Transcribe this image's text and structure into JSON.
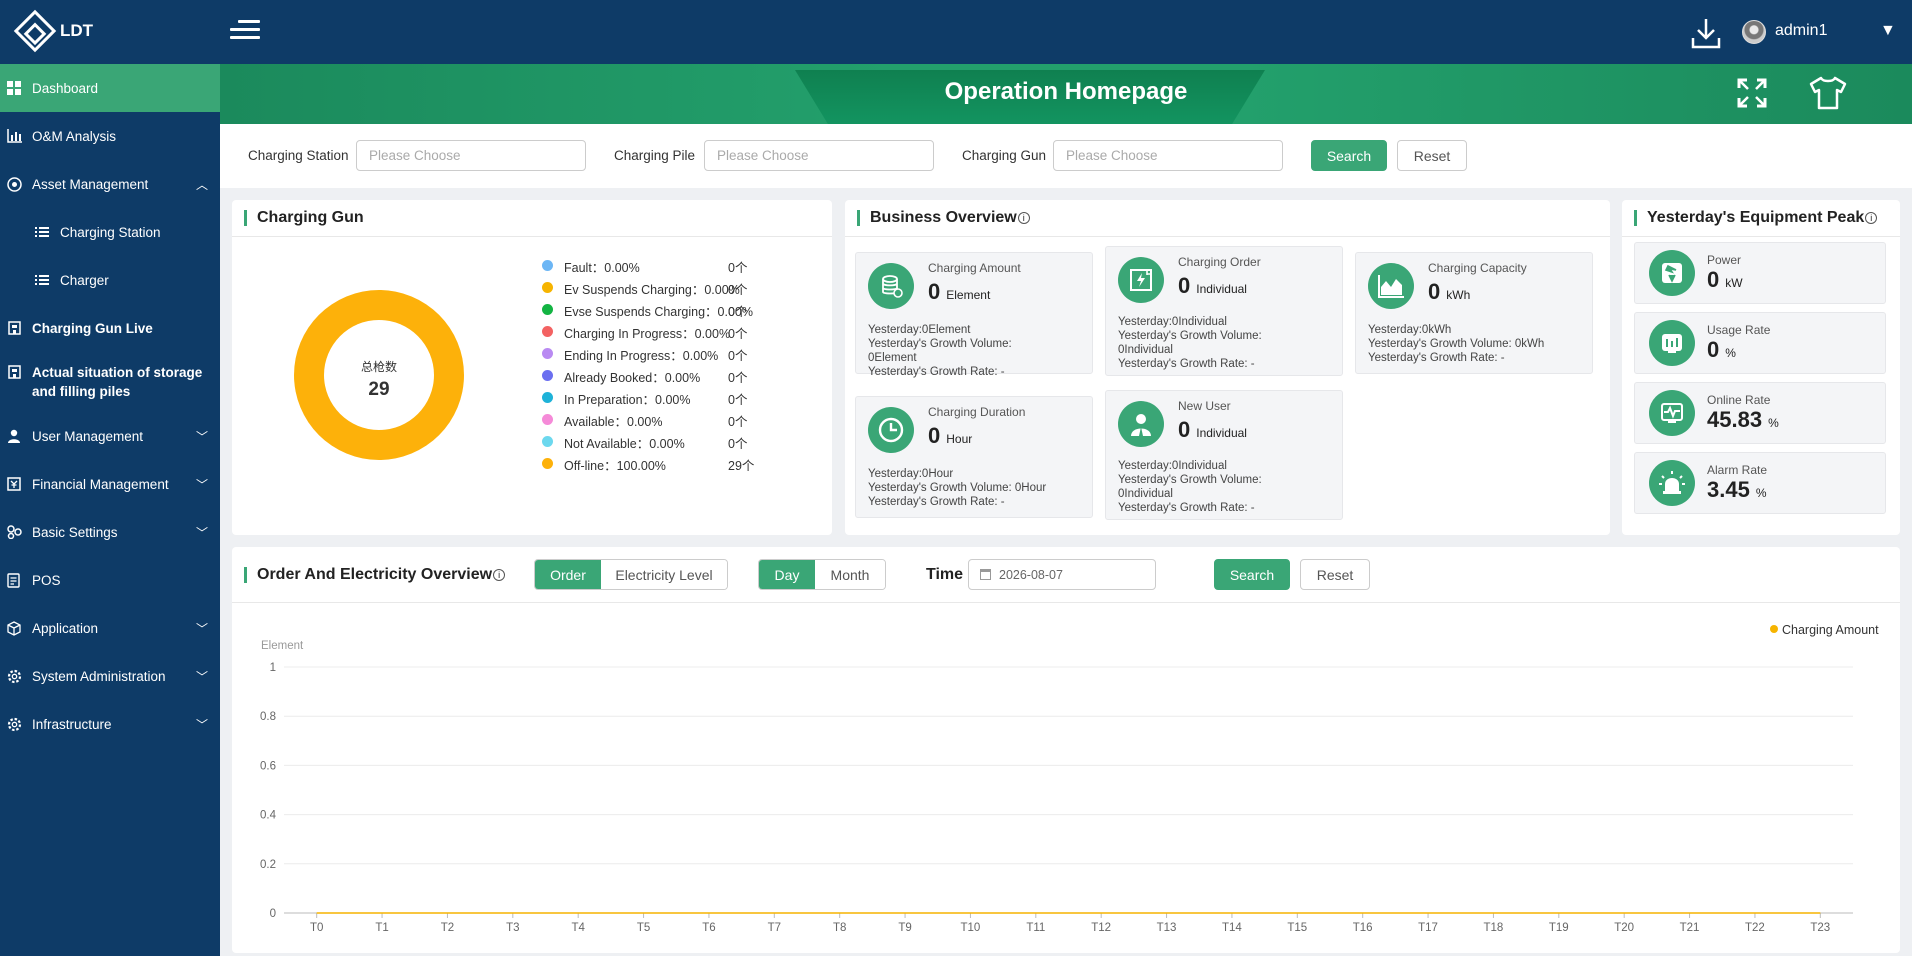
{
  "app": {
    "logo_text": "LDT"
  },
  "header": {
    "user_name": "admin1",
    "caret": "▼"
  },
  "sidebar": {
    "items": [
      {
        "label": "Dashboard",
        "icon": "dashboard-icon",
        "active": true
      },
      {
        "label": "O&M Analysis",
        "icon": "bar-chart-icon"
      },
      {
        "label": "Asset Management",
        "icon": "asset-icon",
        "expanded": true
      },
      {
        "label": "Charging Station",
        "icon": "list-icon",
        "sub": true
      },
      {
        "label": "Charger",
        "icon": "list-icon",
        "sub": true
      },
      {
        "label": "Charging Gun Live",
        "icon": "building-icon"
      },
      {
        "label": "Actual situation of storage and filling piles",
        "icon": "building-icon"
      },
      {
        "label": "User Management",
        "icon": "user-icon",
        "collapsed": true
      },
      {
        "label": "Financial Management",
        "icon": "finance-icon",
        "collapsed": true
      },
      {
        "label": "Basic Settings",
        "icon": "settings-icon",
        "collapsed": true
      },
      {
        "label": "POS",
        "icon": "receipt-icon"
      },
      {
        "label": "Application",
        "icon": "cube-icon",
        "collapsed": true
      },
      {
        "label": "System Administration",
        "icon": "gear-icon",
        "collapsed": true
      },
      {
        "label": "Infrastructure",
        "icon": "gear-icon",
        "collapsed": true
      }
    ],
    "chevron_up": "︿",
    "chevron_down": "﹀"
  },
  "banner": {
    "title": "Operation Homepage"
  },
  "filters": {
    "station_label": "Charging Station",
    "station_placeholder": "Please Choose",
    "pile_label": "Charging Pile",
    "pile_placeholder": "Please Choose",
    "gun_label": "Charging Gun",
    "gun_placeholder": "Please Choose",
    "search_label": "Search",
    "reset_label": "Reset"
  },
  "charging_gun": {
    "title": "Charging Gun",
    "donut_label": "总枪数",
    "donut_value": "29",
    "legend": [
      {
        "label": "Fault：0.00%",
        "count": "0个",
        "color": "#6cb6f5"
      },
      {
        "label": "Ev Suspends Charging：0.00%",
        "count": "0个",
        "color": "#f6b400"
      },
      {
        "label": "Evse Suspends Charging：0.00%",
        "count": "0个",
        "color": "#13b443"
      },
      {
        "label": "Charging In Progress：0.00%",
        "count": "0个",
        "color": "#f36262"
      },
      {
        "label": "Ending In Progress：0.00%",
        "count": "0个",
        "color": "#b98af2"
      },
      {
        "label": "Already Booked：0.00%",
        "count": "0个",
        "color": "#6b6ff0"
      },
      {
        "label": "In Preparation：0.00%",
        "count": "0个",
        "color": "#1eb2d8"
      },
      {
        "label": "Available：0.00%",
        "count": "0个",
        "color": "#f58ad8"
      },
      {
        "label": "Not Available：0.00%",
        "count": "0个",
        "color": "#6cd8ee"
      },
      {
        "label": "Off-line：100.00%",
        "count": "29个",
        "color": "#fdb10a"
      }
    ]
  },
  "business": {
    "title": "Business Overview",
    "info": "i",
    "cards": [
      {
        "label": "Charging Amount",
        "value": "0",
        "unit": "Element",
        "icon": "coins-icon",
        "details": [
          "Yesterday:0Element",
          "Yesterday's Growth Volume: 0Element",
          "Yesterday's Growth Rate: -"
        ]
      },
      {
        "label": "Charging Order",
        "value": "0",
        "unit": "Individual",
        "icon": "order-icon",
        "details": [
          "Yesterday:0Individual",
          "Yesterday's Growth Volume: 0Individual",
          "Yesterday's Growth Rate: -"
        ]
      },
      {
        "label": "Charging Capacity",
        "value": "0",
        "unit": "kWh",
        "icon": "area-chart-icon",
        "details": [
          "Yesterday:0kWh",
          "Yesterday's Growth Volume: 0kWh",
          "Yesterday's Growth Rate: -"
        ]
      },
      {
        "label": "Charging Duration",
        "value": "0",
        "unit": "Hour",
        "icon": "clock-icon",
        "details": [
          "Yesterday:0Hour",
          "Yesterday's Growth Volume: 0Hour",
          "Yesterday's Growth Rate: -"
        ]
      },
      {
        "label": "New User",
        "value": "0",
        "unit": "Individual",
        "icon": "new-user-icon",
        "details": [
          "Yesterday:0Individual",
          "Yesterday's Growth Volume: 0Individual",
          "Yesterday's Growth Rate: -"
        ]
      }
    ]
  },
  "peak": {
    "title": "Yesterday's Equipment Peak",
    "info": "i",
    "cards": [
      {
        "label": "Power",
        "value": "0",
        "unit": "kW",
        "icon": "power-icon"
      },
      {
        "label": "Usage Rate",
        "value": "0",
        "unit": "%",
        "icon": "usage-icon"
      },
      {
        "label": "Online Rate",
        "value": "45.83",
        "unit": "%",
        "icon": "pulse-icon"
      },
      {
        "label": "Alarm Rate",
        "value": "3.45",
        "unit": "%",
        "icon": "alarm-icon"
      }
    ]
  },
  "order": {
    "title": "Order And Electricity Overview",
    "info": "i",
    "tab_order": "Order",
    "tab_electricity": "Electricity Level",
    "tab_day": "Day",
    "tab_month": "Month",
    "time_label": "Time",
    "date_value": "2026-08-07",
    "search_label": "Search",
    "reset_label": "Reset"
  },
  "chart_data": {
    "type": "line",
    "title": "",
    "ylabel": "Element",
    "xlabel": "",
    "categories": [
      "T0",
      "T1",
      "T2",
      "T3",
      "T4",
      "T5",
      "T6",
      "T7",
      "T8",
      "T9",
      "T10",
      "T11",
      "T12",
      "T13",
      "T14",
      "T15",
      "T16",
      "T17",
      "T18",
      "T19",
      "T20",
      "T21",
      "T22",
      "T23"
    ],
    "series": [
      {
        "name": "Charging Amount",
        "color": "#f6b400",
        "values": [
          0,
          0,
          0,
          0,
          0,
          0,
          0,
          0,
          0,
          0,
          0,
          0,
          0,
          0,
          0,
          0,
          0,
          0,
          0,
          0,
          0,
          0,
          0,
          0
        ]
      }
    ],
    "ylim": [
      0,
      1
    ],
    "yticks": [
      "0",
      "0.2",
      "0.4",
      "0.6",
      "0.8",
      "1"
    ],
    "grid": true,
    "legend": "top-right"
  }
}
